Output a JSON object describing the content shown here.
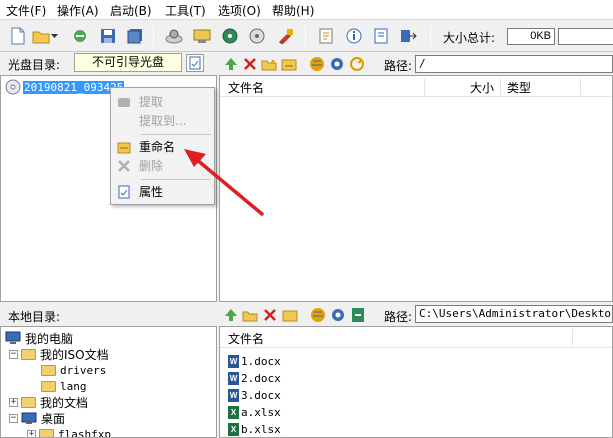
{
  "menu": [
    "文件(F)",
    "操作(A)",
    "启动(B)",
    "工具(T)",
    "选项(O)",
    "帮助(H)"
  ],
  "toolbar": {
    "total_label": "大小总计:",
    "total_value": "0KB"
  },
  "disc": {
    "label": "光盘目录:",
    "type_value": "不可引导光盘",
    "path_label": "路径:",
    "path_value": "/",
    "tree_item": "20190821_093425",
    "columns": [
      "文件名",
      "大小",
      "类型"
    ]
  },
  "context_menu": {
    "extract": "提取",
    "extract_to": "提取到...",
    "rename": "重命名",
    "delete": "删除",
    "properties": "属性"
  },
  "local": {
    "label": "本地目录:",
    "path_label": "路径:",
    "path_value": "C:\\Users\\Administrator\\Desktop\\qq",
    "tree": [
      {
        "label": "我的电脑"
      },
      {
        "label": "我的ISO文档"
      },
      {
        "label": "drivers"
      },
      {
        "label": "lang"
      },
      {
        "label": "我的文档"
      },
      {
        "label": "桌面"
      },
      {
        "label": "flashfxp"
      }
    ],
    "columns": [
      "文件名"
    ],
    "files": [
      {
        "name": "1.docx",
        "type": "word"
      },
      {
        "name": "2.docx",
        "type": "word"
      },
      {
        "name": "3.docx",
        "type": "word"
      },
      {
        "name": "a.xlsx",
        "type": "excel"
      },
      {
        "name": "b.xlsx",
        "type": "excel"
      }
    ]
  },
  "colors": {
    "selection": "#3399ff",
    "arrow": "#e02020",
    "disc_type_bg": "#ffffe1"
  }
}
